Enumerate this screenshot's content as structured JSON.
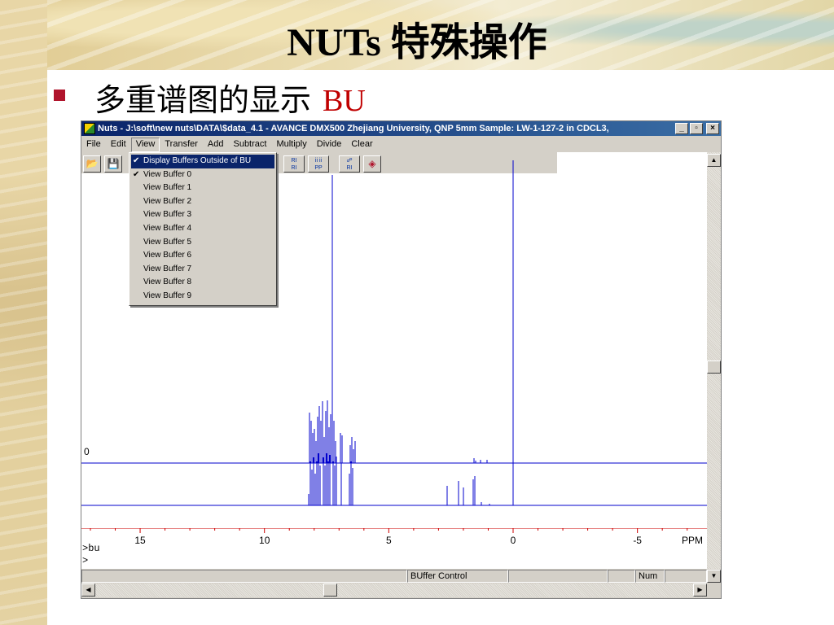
{
  "slide": {
    "title": "NUTs 特殊操作",
    "bullet_text": "多重谱图的显示",
    "bullet_accent": "BU",
    "accent_color": "#c00000",
    "bullet_color": "#b0142c"
  },
  "window": {
    "title": "Nuts - J:\\soft\\new nuts\\DATA\\$data_4.1 - AVANCE DMX500 Zhejiang University, QNP 5mm Sample: LW-1-127-2 in CDCL3,",
    "min_label": "_",
    "max_label": "▫",
    "close_label": "×",
    "menubar": [
      "File",
      "Edit",
      "View",
      "Transfer",
      "Add",
      "Subtract",
      "Multiply",
      "Divide",
      "Clear"
    ],
    "active_menu": "View"
  },
  "toolbar": {
    "icons": [
      "open-folder-icon",
      "save-icon"
    ],
    "small_icons": [
      "RI",
      "ii ii PP",
      "RI",
      "book-icon"
    ]
  },
  "view_menu": {
    "items": [
      {
        "label": "Display Buffers Outside of BU",
        "checked": true,
        "highlighted": true
      },
      {
        "label": "View Buffer 0",
        "checked": true
      },
      {
        "label": "View Buffer 1"
      },
      {
        "label": "View Buffer 2"
      },
      {
        "label": "View Buffer 3"
      },
      {
        "label": "View Buffer 4"
      },
      {
        "label": "View Buffer 5"
      },
      {
        "label": "View Buffer 6"
      },
      {
        "label": "View Buffer 7"
      },
      {
        "label": "View Buffer 8"
      },
      {
        "label": "View Buffer 9"
      }
    ]
  },
  "plot": {
    "zero_label": "0",
    "axis_ticks": [
      "15",
      "10",
      "5",
      "0",
      "-5"
    ],
    "axis_unit": "PPM",
    "spectrum_color": "#0000cc",
    "axis_color": "#cc0000"
  },
  "command_lines": [
    ">bu",
    ">"
  ],
  "statusbar": {
    "buffer_control": "BUffer Control",
    "num": "Num"
  }
}
